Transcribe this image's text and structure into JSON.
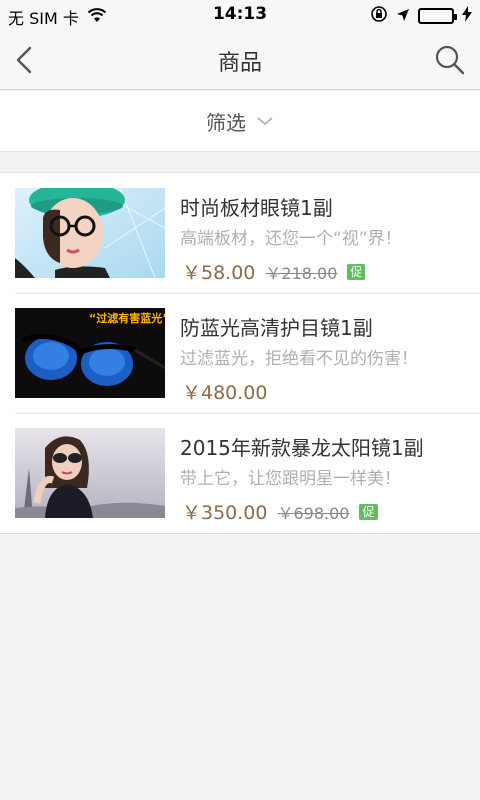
{
  "status": {
    "carrier": "无 SIM 卡",
    "time": "14:13",
    "battery_level": 1.0
  },
  "nav": {
    "title": "商品"
  },
  "filter": {
    "label": "筛选"
  },
  "colors": {
    "price": "#8b6b4a",
    "promo": "#5cc05c",
    "battery": "#4cd964"
  },
  "products": [
    {
      "name": "时尚板材眼镜1副",
      "desc": "高端板材，还您一个“视”界！",
      "price": "￥58.00",
      "orig_price": "￥218.00",
      "promo": "促"
    },
    {
      "name": "防蓝光高清护目镜1副",
      "desc": "过滤蓝光，拒绝看不见的伤害！",
      "price": "￥480.00",
      "thumb_text": "“过滤有害蓝光”"
    },
    {
      "name": "2015年新款暴龙太阳镜1副",
      "desc": "带上它，让您跟明星一样美！",
      "price": "￥350.00",
      "orig_price": "￥698.00",
      "promo": "促"
    }
  ]
}
